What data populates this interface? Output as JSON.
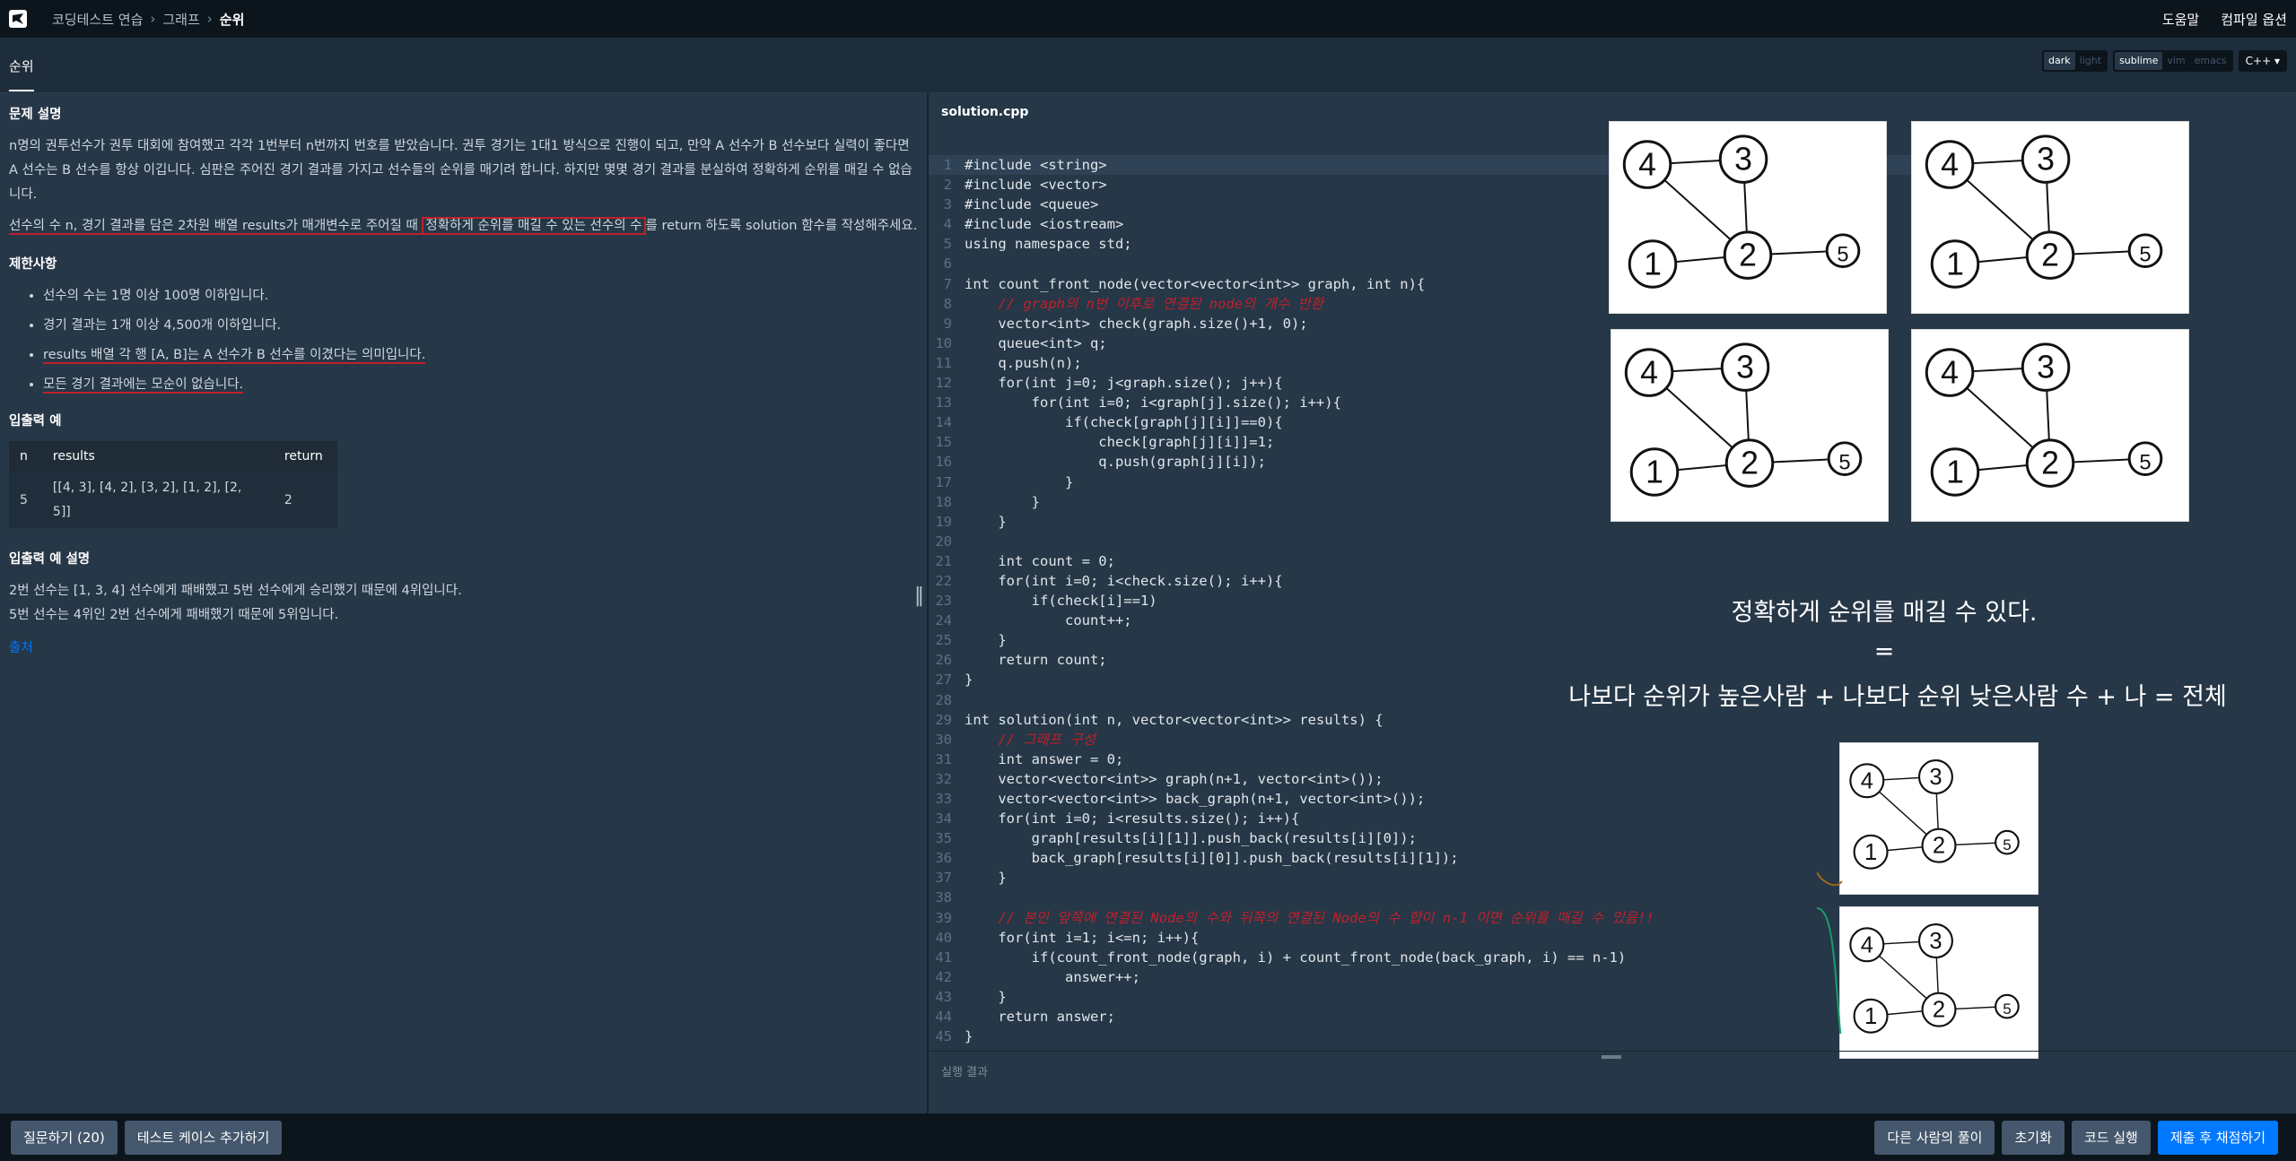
{
  "topbar": {
    "breadcrumb": [
      "코딩테스트 연습",
      "그래프",
      "순위"
    ],
    "help": "도움말",
    "compile_options": "컴파일 옵션"
  },
  "subbar": {
    "title": "순위",
    "theme_options": [
      "dark",
      "light"
    ],
    "keymap_options": [
      "sublime",
      "vim",
      "emacs"
    ],
    "language": "C++"
  },
  "problem": {
    "desc_title": "문제 설명",
    "desc_p1": "n명의 권투선수가 권투 대회에 참여했고 각각 1번부터 n번까지 번호를 받았습니다. 권투 경기는 1대1 방식으로 진행이 되고, 만약 A 선수가 B 선수보다 실력이 좋다면 A 선수는 B 선수를 항상 이깁니다. 심판은 주어진 경기 결과를 가지고 선수들의 순위를 매기려 합니다. 하지만 몇몇 경기 결과를 분실하여 정확하게 순위를 매길 수 없습니다.",
    "desc_p2_a": "선수의 수 n, 경기 결과를 담은 2차원 배열 results가 매개변수로 주어질 때 ",
    "desc_p2_b": "정확하게 순위를 매길 수 있는 선수의 수",
    "desc_p2_c": "를 return 하도록 solution 함수를 작성해주세요.",
    "limits_title": "제한사항",
    "limits": [
      "선수의 수는 1명 이상 100명 이하입니다.",
      "경기 결과는 1개 이상 4,500개 이하입니다.",
      "results 배열 각 행 [A, B]는 A 선수가 B 선수를 이겼다는 의미입니다.",
      "모든 경기 결과에는 모순이 없습니다."
    ],
    "io_title": "입출력 예",
    "io_headers": [
      "n",
      "results",
      "return"
    ],
    "io_row": [
      "5",
      "[[4, 3], [4, 2], [3, 2], [1, 2], [2, 5]]",
      "2"
    ],
    "io_desc_title": "입출력 예 설명",
    "io_desc": [
      "2번 선수는 [1, 3, 4] 선수에게 패배했고 5번 선수에게 승리했기 때문에 4위입니다.",
      "5번 선수는 4위인 2번 선수에게 패배했기 때문에 5위입니다."
    ],
    "source": "출처"
  },
  "editor": {
    "filename": "solution.cpp",
    "result_label": "실행 결과"
  },
  "code_lines": [
    "#include <string>",
    "#include <vector>",
    "#include <queue>",
    "#include <iostream>",
    "using namespace std;",
    "",
    "int count_front_node(vector<vector<int>> graph, int n){",
    "    // graph의 n번 이후로 연결된 node의 개수 반환",
    "    vector<int> check(graph.size()+1, 0);",
    "    queue<int> q;",
    "    q.push(n);",
    "    for(int j=0; j<graph.size(); j++){",
    "        for(int i=0; i<graph[j].size(); i++){",
    "            if(check[graph[j][i]]==0){",
    "                check[graph[j][i]]=1;",
    "                q.push(graph[j][i]);",
    "            }",
    "        }",
    "    }",
    "",
    "    int count = 0;",
    "    for(int i=0; i<check.size(); i++){",
    "        if(check[i]==1)",
    "            count++;",
    "    }",
    "    return count;",
    "}",
    "",
    "int solution(int n, vector<vector<int>> results) {",
    "    // 그래프 구성",
    "    int answer = 0;",
    "    vector<vector<int>> graph(n+1, vector<int>());",
    "    vector<vector<int>> back_graph(n+1, vector<int>());",
    "    for(int i=0; i<results.size(); i++){",
    "        graph[results[i][1]].push_back(results[i][0]);",
    "        back_graph[results[i][0]].push_back(results[i][1]);",
    "    }",
    "",
    "    // 본인 앞쪽에 연결된 Node의 수와 뒤쪽의 연결된 Node의 수 합이 n-1 이면 순위를 매길 수 있음!!",
    "    for(int i=1; i<=n; i++){",
    "        if(count_front_node(graph, i) + count_front_node(back_graph, i) == n-1)",
    "            answer++;",
    "    }",
    "    return answer;",
    "}"
  ],
  "notes": {
    "line1": "정확하게 순위를 매길 수 있다.",
    "line2": "=",
    "line3": "나보다 순위가 높은사람 + 나보다 순위 낮은사람 수 + 나 = 전체"
  },
  "sketch_nodes": [
    "4",
    "3",
    "1",
    "2",
    "5"
  ],
  "bottom": {
    "ask": "질문하기 (20)",
    "add_test": "테스트 케이스 추가하기",
    "others": "다른 사람의 풀이",
    "reset": "초기화",
    "run": "코드 실행",
    "submit": "제출 후 채점하기"
  },
  "colors": {
    "accent": "#0078ff",
    "annotation_red": "#c0202a",
    "annotation_blue": "#2a3fd0",
    "annotation_brown": "#9a6a1a",
    "annotation_green": "#1a9a6a"
  }
}
